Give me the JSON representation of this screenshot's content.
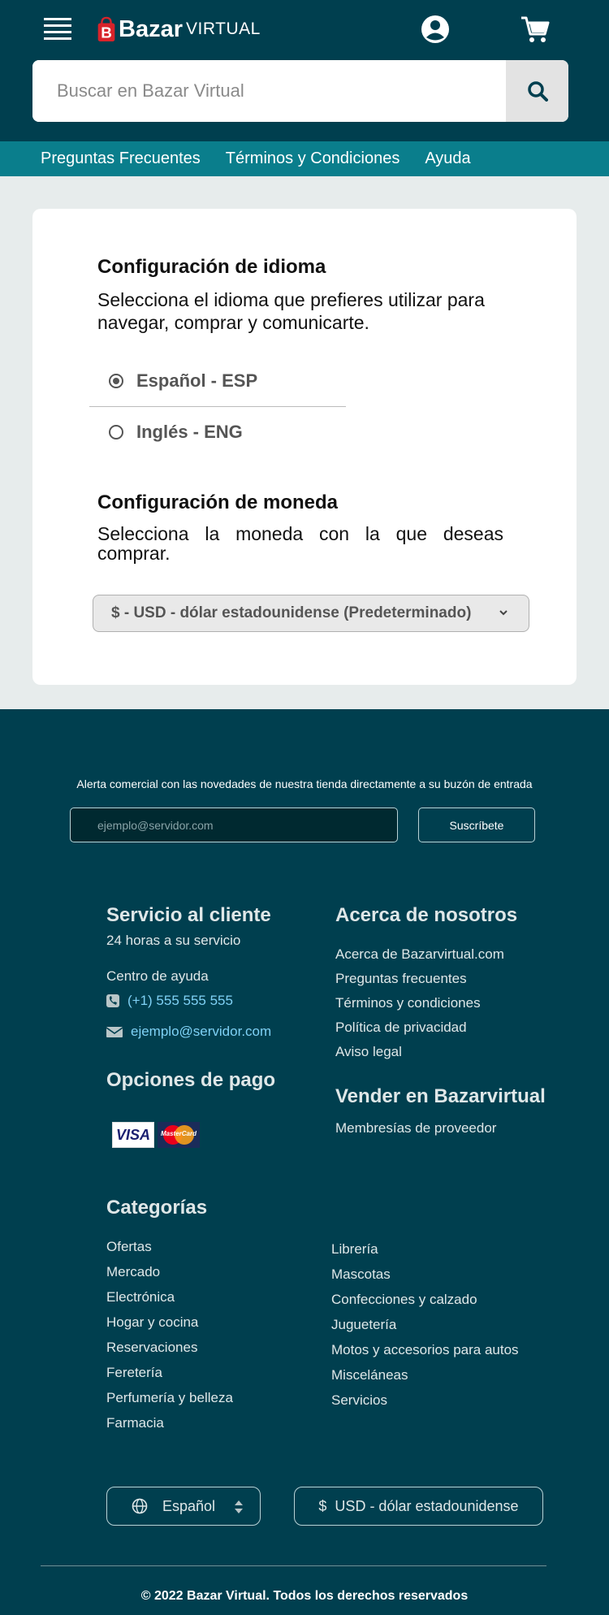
{
  "header": {
    "logo_main": "Bazar",
    "logo_sub": "VIRTUAL",
    "search_placeholder": "Buscar en Bazar Virtual",
    "icons": [
      "menu-icon",
      "user-icon",
      "cart-icon",
      "search-icon"
    ]
  },
  "subnav": {
    "items": [
      "Preguntas Frecuentes",
      "Términos y Condiciones",
      "Ayuda"
    ]
  },
  "language_settings": {
    "title": "Configuración de idioma",
    "description": "Selecciona el idioma que prefieres utilizar para navegar, comprar y comunicarte.",
    "options": [
      {
        "label": "Español - ESP",
        "selected": true
      },
      {
        "label": "Inglés - ENG",
        "selected": false
      }
    ]
  },
  "currency_settings": {
    "title": "Configuración de moneda",
    "description": "Selecciona la moneda con la que deseas comprar.",
    "selected": "$ - USD - dólar estadounidense (Predeterminado)"
  },
  "newsletter": {
    "text": "Alerta comercial con las novedades de nuestra tienda directamente a su buzón de entrada",
    "placeholder": "ejemplo@servidor.com",
    "button": "Suscríbete"
  },
  "customer_service": {
    "title": "Servicio al cliente",
    "subtitle": "24 horas a su servicio",
    "help_center": "Centro de ayuda",
    "phone": "(+1) 555 555 555",
    "email": "ejemplo@servidor.com"
  },
  "about": {
    "title": "Acerca de nosotros",
    "links": [
      "Acerca de Bazarvirtual.com",
      "Preguntas frecuentes",
      "Términos y condiciones",
      "Política de privacidad",
      "Aviso legal"
    ]
  },
  "payment": {
    "title": "Opciones de pago",
    "visa": "VISA",
    "mastercard": "MasterCard"
  },
  "sell": {
    "title": "Vender en Bazarvirtual",
    "link": "Membresías de proveedor"
  },
  "categories": {
    "title": "Categorías",
    "col1": [
      "Ofertas",
      "Mercado",
      "Electrónica",
      "Hogar y cocina",
      "Reservaciones",
      "Feretería",
      "Perfumería y belleza",
      "Farmacia"
    ],
    "col2": [
      "Librería",
      "Mascotas",
      "Confecciones y calzado",
      "Juguetería",
      "Motos y accesorios para autos",
      "Misceláneas",
      "Servicios"
    ]
  },
  "footer_controls": {
    "language": "Español",
    "currency": "$  USD - dólar estadounidense"
  },
  "copyright": "© 2022  Bazar Virtual. Todos los derechos reservados",
  "colors": {
    "header_bg": "#003f4f",
    "subnav_bg": "#0a7e8c",
    "accent_link": "#7fd1f5",
    "logo_red": "#d8232a"
  }
}
